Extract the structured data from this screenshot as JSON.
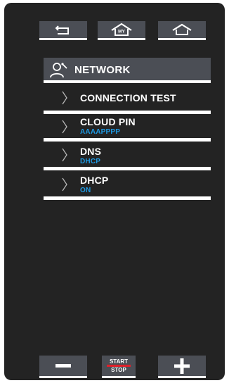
{
  "top_buttons": [
    {
      "icon": "back-arrow-icon"
    },
    {
      "icon": "my-home-icon",
      "badge": "MY"
    },
    {
      "icon": "home-icon"
    }
  ],
  "header": {
    "icon": "user-settings-icon",
    "title": "NETWORK"
  },
  "menu_items": [
    {
      "label": "CONNECTION TEST",
      "value": ""
    },
    {
      "label": "CLOUD PIN",
      "value": "AAAAPPPP"
    },
    {
      "label": "DNS",
      "value": "DHCP"
    },
    {
      "label": "DHCP",
      "value": "ON"
    }
  ],
  "bottom_controls": {
    "minus_icon": "minus-icon",
    "start_label": "START",
    "stop_label": "STOP",
    "plus_icon": "plus-icon"
  },
  "colors": {
    "panel": "#232323",
    "button": "#4b4e55",
    "value_text": "#1e9be6",
    "start_stop_accent": "#e0202a"
  }
}
